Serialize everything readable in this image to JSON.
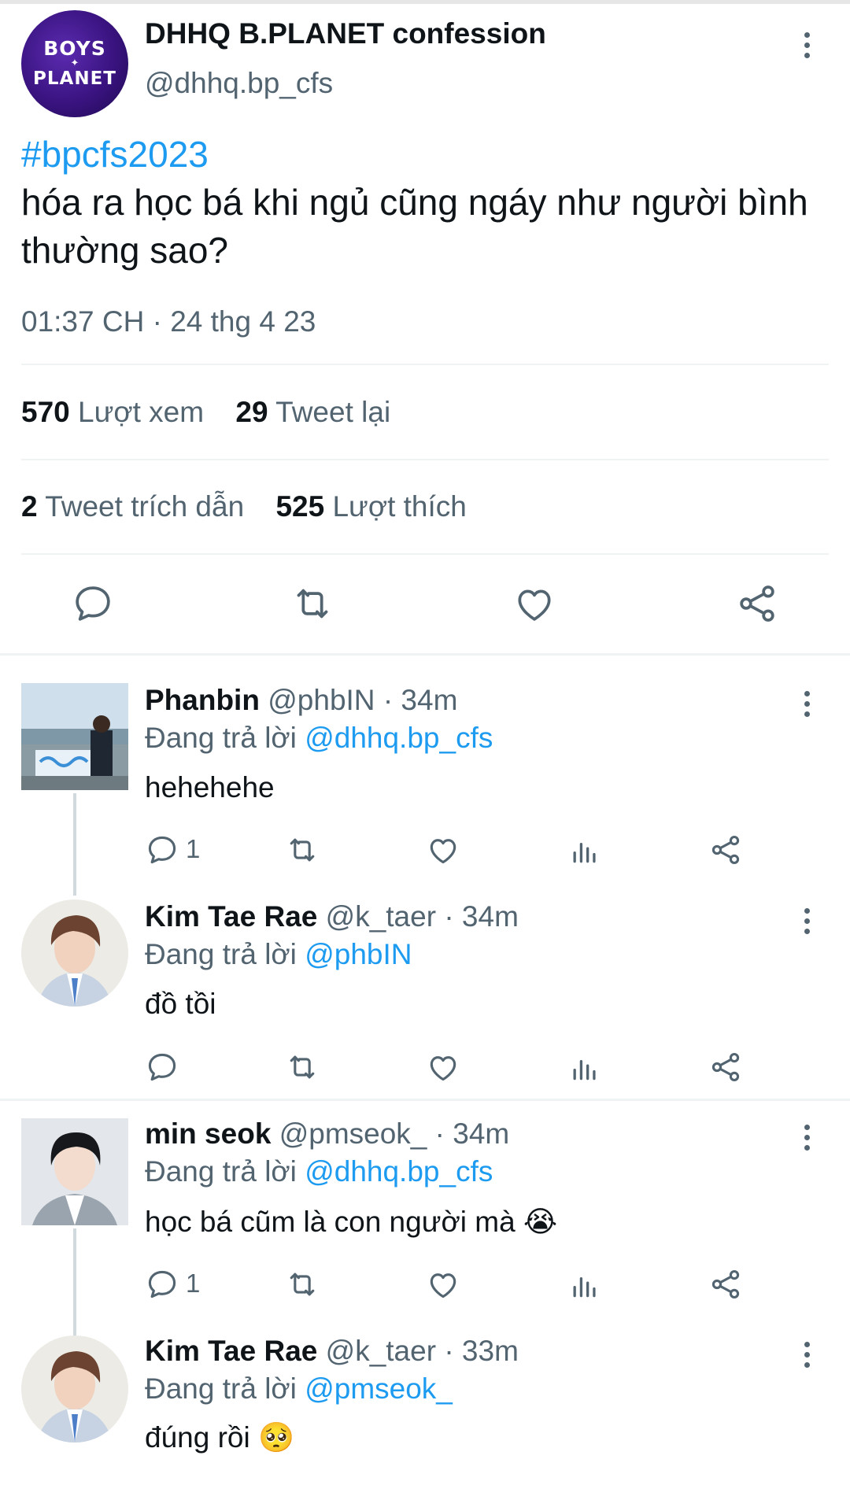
{
  "main_tweet": {
    "avatar_text_line1": "BOYS",
    "avatar_text_line2": "PLANET",
    "display_name": "DHHQ B.PLANET confession",
    "handle": "@dhhq.bp_cfs",
    "hashtag": "#bpcfs2023",
    "text": "hóa ra học bá khi ngủ cũng ngáy như người bình thường sao?",
    "timestamp": "01:37 CH · 24 thg 4 23",
    "views_count": "570",
    "views_label": "Lượt xem",
    "retweets_count": "29",
    "retweets_label": "Tweet lại",
    "quotes_count": "2",
    "quotes_label": "Tweet trích dẫn",
    "likes_count": "525",
    "likes_label": "Lượt thích"
  },
  "replies": [
    {
      "name": "Phanbin",
      "handle": "@phbIN",
      "time": "· 34m",
      "replying_prefix": "Đang trả lời",
      "replying_to": "@dhhq.bp_cfs",
      "text": "hehehehe",
      "reply_count": "1"
    },
    {
      "name": "Kim Tae Rae",
      "handle": "@k_taer",
      "time": "· 34m",
      "replying_prefix": "Đang trả lời",
      "replying_to": "@phbIN",
      "text": "đồ tồi",
      "reply_count": ""
    },
    {
      "name": "min seok",
      "handle": "@pmseok_",
      "time": "· 34m",
      "replying_prefix": "Đang trả lời",
      "replying_to": "@dhhq.bp_cfs",
      "text": "học bá cũm là con người mà 😭",
      "reply_count": "1"
    },
    {
      "name": "Kim Tae Rae",
      "handle": "@k_taer",
      "time": "· 33m",
      "replying_prefix": "Đang trả lời",
      "replying_to": "@pmseok_",
      "text": "đúng rồi 🥺",
      "reply_count": ""
    }
  ],
  "icons": [
    "reply-icon",
    "retweet-icon",
    "like-icon",
    "share-icon",
    "views-icon",
    "more-icon"
  ],
  "colors": {
    "link": "#1d9bf0",
    "muted": "#536471",
    "text": "#0f1419",
    "divider": "#eff3f4"
  }
}
